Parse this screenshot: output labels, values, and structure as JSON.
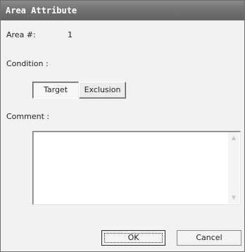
{
  "window": {
    "title": "Area Attribute"
  },
  "area": {
    "label": "Area #:",
    "value": "1"
  },
  "condition": {
    "label": "Condition :",
    "options": [
      "Target",
      "Exclusion"
    ],
    "selected": "Target"
  },
  "comment": {
    "label": "Comment :",
    "value": ""
  },
  "buttons": {
    "ok": "OK",
    "cancel": "Cancel"
  },
  "icons": {
    "scroll_up": "scroll-up-arrow-icon",
    "scroll_down": "scroll-down-arrow-icon"
  }
}
